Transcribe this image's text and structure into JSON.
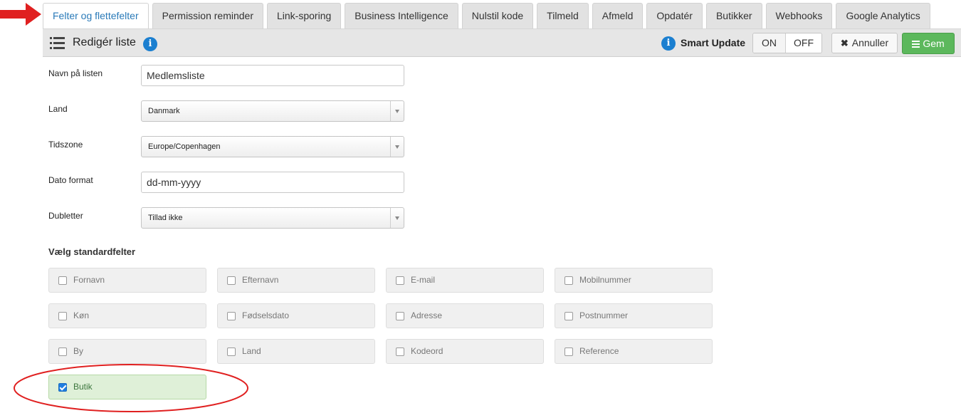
{
  "tabs": [
    {
      "label": "Felter og flettefelter",
      "active": true
    },
    {
      "label": "Permission reminder",
      "active": false
    },
    {
      "label": "Link-sporing",
      "active": false
    },
    {
      "label": "Business Intelligence",
      "active": false
    },
    {
      "label": "Nulstil kode",
      "active": false
    },
    {
      "label": "Tilmeld",
      "active": false
    },
    {
      "label": "Afmeld",
      "active": false
    },
    {
      "label": "Opdatér",
      "active": false
    },
    {
      "label": "Butikker",
      "active": false
    },
    {
      "label": "Webhooks",
      "active": false
    },
    {
      "label": "Google Analytics",
      "active": false
    }
  ],
  "toolbar": {
    "title": "Redigér liste",
    "info_glyph": "i",
    "smart_update_label": "Smart Update",
    "on_label": "ON",
    "off_label": "OFF",
    "cancel_label": "Annuller",
    "cancel_glyph": "✖",
    "save_label": "Gem"
  },
  "form": {
    "list_name": {
      "label": "Navn på listen",
      "value": "Medlemsliste"
    },
    "country": {
      "label": "Land",
      "value": "Danmark"
    },
    "timezone": {
      "label": "Tidszone",
      "value": "Europe/Copenhagen"
    },
    "date_format": {
      "label": "Dato format",
      "value": "dd-mm-yyyy"
    },
    "duplicates": {
      "label": "Dubletter",
      "value": "Tillad ikke"
    }
  },
  "standard_fields": {
    "title": "Vælg standardfelter",
    "items": [
      {
        "label": "Fornavn",
        "checked": false
      },
      {
        "label": "Efternavn",
        "checked": false
      },
      {
        "label": "E-mail",
        "checked": false
      },
      {
        "label": "Mobilnummer",
        "checked": false
      },
      {
        "label": "Køn",
        "checked": false
      },
      {
        "label": "Fødselsdato",
        "checked": false
      },
      {
        "label": "Adresse",
        "checked": false
      },
      {
        "label": "Postnummer",
        "checked": false
      },
      {
        "label": "By",
        "checked": false
      },
      {
        "label": "Land",
        "checked": false
      },
      {
        "label": "Kodeord",
        "checked": false
      },
      {
        "label": "Reference",
        "checked": false
      },
      {
        "label": "Butik",
        "checked": true
      }
    ]
  },
  "colors": {
    "active_tab_text": "#2a7ab8",
    "info_icon": "#1b7fd0",
    "save_button": "#5cb85c",
    "checked_field_bg": "#dff0d8",
    "annotation_red": "#e02020"
  },
  "icons": {
    "title_icon": "list-icon",
    "info_icon": "info-icon",
    "cancel_icon": "close-icon",
    "save_icon": "list-icon",
    "annotation": "red-arrow-icon"
  }
}
